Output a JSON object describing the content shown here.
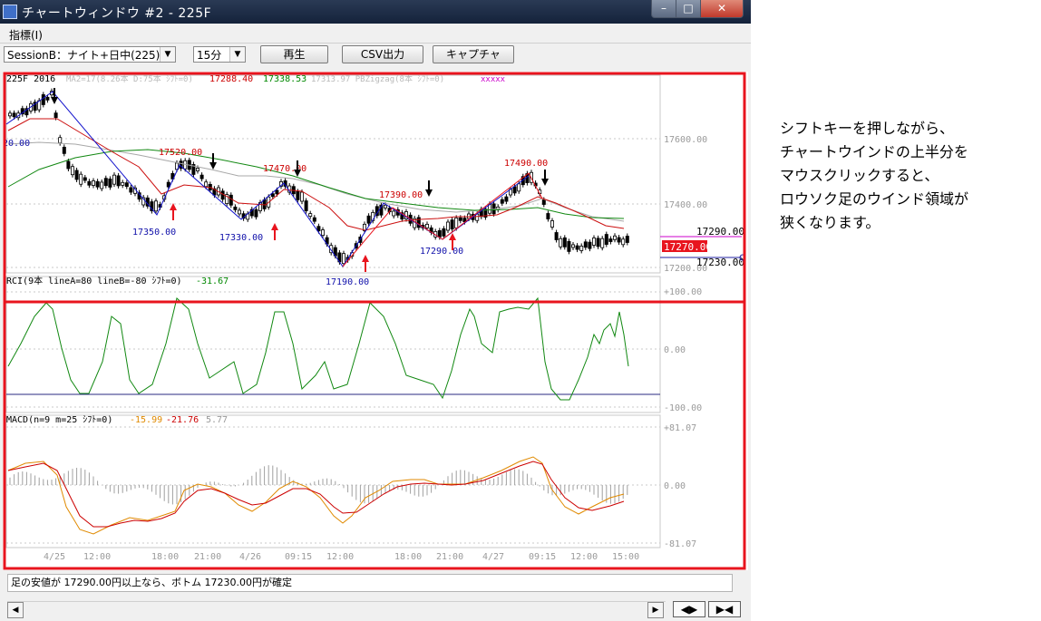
{
  "window": {
    "title": "チャートウィンドウ #2 - 225F",
    "controls": {
      "minimize": "–",
      "maximize": "□",
      "close": "✕"
    }
  },
  "menu": {
    "items": [
      {
        "label": "指標(I)"
      }
    ]
  },
  "toolbar": {
    "session_value": "SessionB：ナイト+日中(225)",
    "interval_value": "15分",
    "play_label": "再生",
    "csv_label": "CSV出力",
    "capture_label": "キャプチャ"
  },
  "price_panel": {
    "header_left": "225F 2016",
    "header_faded": "MA2=17(8.26本 D:75本 ｼﾌﾄ=0)",
    "header_v1": "17288.40",
    "header_v2": "17338.53",
    "header_faded2": "17313.97 PBZigzag(8本 ｼﾌﾄ=0)",
    "header_faded3": "xxxxx",
    "header_colors": {
      "v1": "#cc0000",
      "v2": "#008800"
    },
    "y_ticks": [
      "17600.00",
      "17400.00",
      "17200.00"
    ],
    "right_labels": {
      "upper": "17290.00",
      "current": "17270.00",
      "lower": "17230.00"
    },
    "left_cut_label": "20.00",
    "zigzag_labels": {
      "high1": "17520.00",
      "low1": "17350.00",
      "low2": "17330.00",
      "high2": "17470.00",
      "low3": "17190.00",
      "high3": "17390.00",
      "low4": "17290.00",
      "high4": "17490.00"
    }
  },
  "rci_panel": {
    "header": "RCI(9本 lineA=80 lineB=-80 ｼﾌﾄ=0)",
    "value": "-31.67",
    "y_ticks": [
      "+100.00",
      "0.00",
      "-100.00"
    ]
  },
  "macd_panel": {
    "header": "MACD(n=9 m=25 ｼﾌﾄ=0)",
    "v1": "-15.99",
    "v2": "-21.76",
    "v3": "5.77",
    "y_ticks": [
      "+81.07",
      "0.00",
      "-81.07"
    ],
    "colors": {
      "macd": "#e08a00",
      "signal": "#cc0000",
      "hist": "#9a9a9a"
    }
  },
  "x_axis": {
    "labels": [
      "4/25",
      "12:00",
      "18:00",
      "21:00",
      "4/26",
      "09:15",
      "12:00",
      "18:00",
      "21:00",
      "4/27",
      "09:15",
      "12:00",
      "15:00"
    ]
  },
  "status": {
    "text": "足の安値が 17290.00円以上なら、ボトム 17230.00円が確定"
  },
  "nav": {
    "left_right": "◀▶",
    "bowtie": "▶◀"
  },
  "note": {
    "lines": [
      "シフトキーを押しながら、",
      "チャートウインドの上半分を",
      "マウスクリックすると、",
      "ロウソク足のウインド領域が",
      "狭くなります。"
    ]
  },
  "annotation": {
    "highlight_color": "#e8141e"
  }
}
